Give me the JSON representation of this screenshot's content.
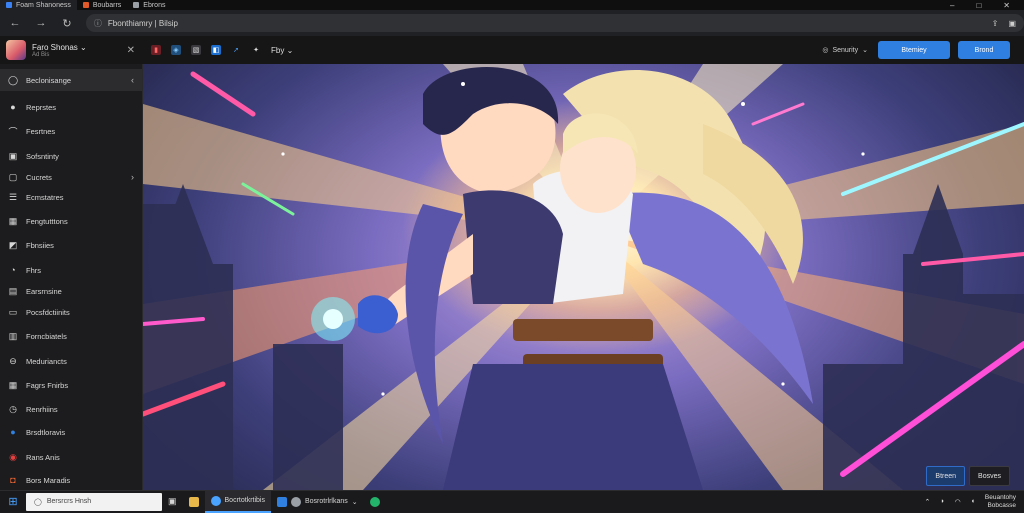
{
  "browser": {
    "tabs": [
      {
        "label": "Foam Shanoness",
        "color": "#3b82f6"
      },
      {
        "label": "Boubarrs",
        "color": "#e05a2a"
      },
      {
        "label": "Ebrons",
        "color": "#9aa0a6"
      }
    ],
    "window_controls": [
      "–",
      "□",
      "✕"
    ],
    "url": "Fbonthiamry | Bilsip",
    "nav": {
      "back": "←",
      "forward": "→",
      "reload": "↻"
    }
  },
  "app": {
    "user": {
      "name": "Faro Shonas",
      "sub": "Ad Bis"
    },
    "toolbar_text": "Fby",
    "security_label": "Senurity",
    "action_btn_1": "Btemiey",
    "action_btn_2": "Brond"
  },
  "sidebar": {
    "items": [
      {
        "label": "Beclonisange",
        "icon": "chat-icon",
        "glyph": "◯",
        "chevron": "‹",
        "active": true
      },
      {
        "label": "Reprstes",
        "icon": "dot-icon",
        "glyph": "●"
      },
      {
        "label": "Fesrtnes",
        "icon": "clip-icon",
        "glyph": "⌒"
      },
      {
        "label": "Sofsntinty",
        "icon": "image-icon",
        "glyph": "▣"
      },
      {
        "label": "Cucrets",
        "icon": "layers-icon",
        "glyph": "▢",
        "chevron": "›"
      },
      {
        "label": "Ecmstatres",
        "icon": "list-icon",
        "glyph": "☰"
      },
      {
        "label": "Fengtutttons",
        "icon": "grid-icon",
        "glyph": "▦"
      },
      {
        "label": "Fbnsiies",
        "icon": "folder-icon",
        "glyph": "◩"
      },
      {
        "label": "Fhrs",
        "icon": "refresh-icon",
        "glyph": "◔"
      },
      {
        "label": "Earsrnsine",
        "icon": "clipboard-icon",
        "glyph": "▤"
      },
      {
        "label": "Pocsfdctiinits",
        "icon": "album-icon",
        "glyph": "▭"
      },
      {
        "label": "Forncbiatels",
        "icon": "doc-icon",
        "glyph": "▥"
      },
      {
        "label": "Meduriancts",
        "icon": "minus-circle-icon",
        "glyph": "⊖"
      },
      {
        "label": "Fagrs Fnirbs",
        "icon": "calendar-icon",
        "glyph": "▦"
      },
      {
        "label": "Renrhiins",
        "icon": "clock-icon",
        "glyph": "◷"
      },
      {
        "label": "Brsdtloravis",
        "icon": "cloud-icon",
        "glyph": "●",
        "color": "#2f80e0"
      },
      {
        "label": "Rans Anis",
        "icon": "alert-icon",
        "glyph": "◉",
        "color": "#e04040"
      },
      {
        "label": "Bors Maradis",
        "icon": "flag-icon",
        "glyph": "◘",
        "color": "#e06030"
      }
    ]
  },
  "canvas": {
    "overlay_btn_1": "Btreen",
    "overlay_btn_2": "Bosves"
  },
  "taskbar": {
    "start_glyph": "⊞",
    "search_text": "Bersrcrs Hnsh",
    "apps": [
      {
        "label": "Bocrtotkrtibis",
        "color": "#4aa3ff"
      },
      {
        "label": "Bosrotrlrlkans",
        "color": "#9aa0a6"
      }
    ],
    "clock_line1": "Beuantohy",
    "clock_line2": "Bobcasse"
  }
}
